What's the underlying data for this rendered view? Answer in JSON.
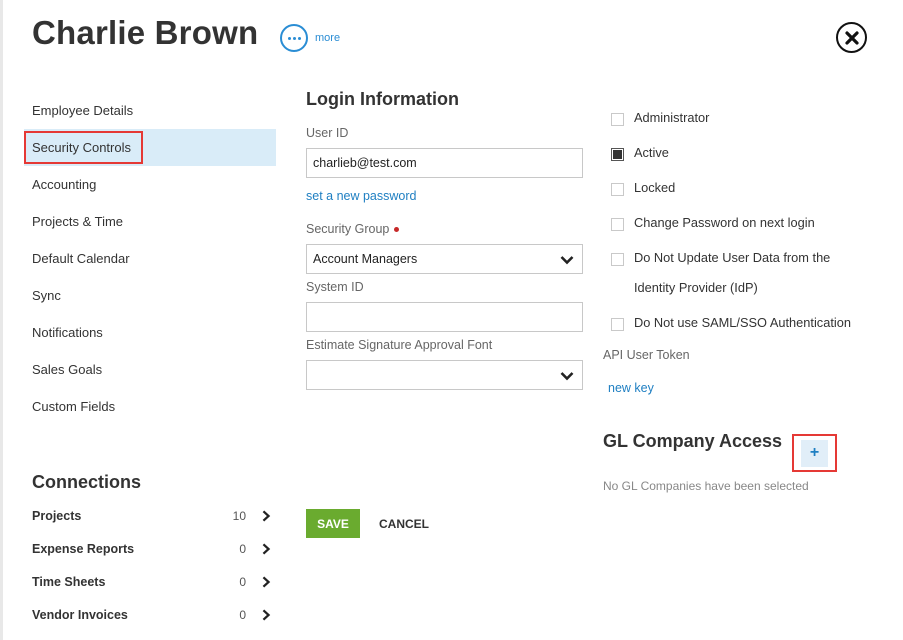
{
  "header": {
    "title": "Charlie Brown",
    "more_label": "more"
  },
  "nav": {
    "items": [
      {
        "label": "Employee Details"
      },
      {
        "label": "Security Controls"
      },
      {
        "label": "Accounting"
      },
      {
        "label": "Projects & Time"
      },
      {
        "label": "Default Calendar"
      },
      {
        "label": "Sync"
      },
      {
        "label": "Notifications"
      },
      {
        "label": "Sales Goals"
      },
      {
        "label": "Custom Fields"
      }
    ],
    "active_index": 1
  },
  "connections": {
    "title": "Connections",
    "rows": [
      {
        "name": "Projects",
        "count": "10"
      },
      {
        "name": "Expense Reports",
        "count": "0"
      },
      {
        "name": "Time Sheets",
        "count": "0"
      },
      {
        "name": "Vendor Invoices",
        "count": "0"
      }
    ]
  },
  "login": {
    "title": "Login Information",
    "user_id_label": "User ID",
    "user_id_value": "charlieb@test.com",
    "set_password_link": "set a new password",
    "security_group_label": "Security Group",
    "security_group_value": "Account Managers",
    "system_id_label": "System ID",
    "system_id_value": "",
    "font_label": "Estimate Signature Approval Font",
    "font_value": ""
  },
  "actions": {
    "save_label": "SAVE",
    "cancel_label": "CANCEL"
  },
  "options": {
    "checkboxes": [
      {
        "label": "Administrator",
        "checked": false
      },
      {
        "label": "Active",
        "checked": true
      },
      {
        "label": "Locked",
        "checked": false
      },
      {
        "label": "Change Password on next login",
        "checked": false
      },
      {
        "label_line1": "Do Not Update User Data from the",
        "label_line2": "Identity Provider (IdP)",
        "checked": false
      },
      {
        "label": "Do Not use SAML/SSO Authentication",
        "checked": false
      }
    ],
    "api_token_label": "API User Token",
    "new_key_link": "new key"
  },
  "gl": {
    "title": "GL Company Access",
    "add_symbol": "+",
    "empty_text": "No GL Companies have been selected"
  },
  "colors": {
    "accent_blue": "#2a8dd4",
    "save_green": "#6aab2f",
    "highlight_red": "#e53935",
    "active_nav_bg": "#d9ecf8"
  }
}
